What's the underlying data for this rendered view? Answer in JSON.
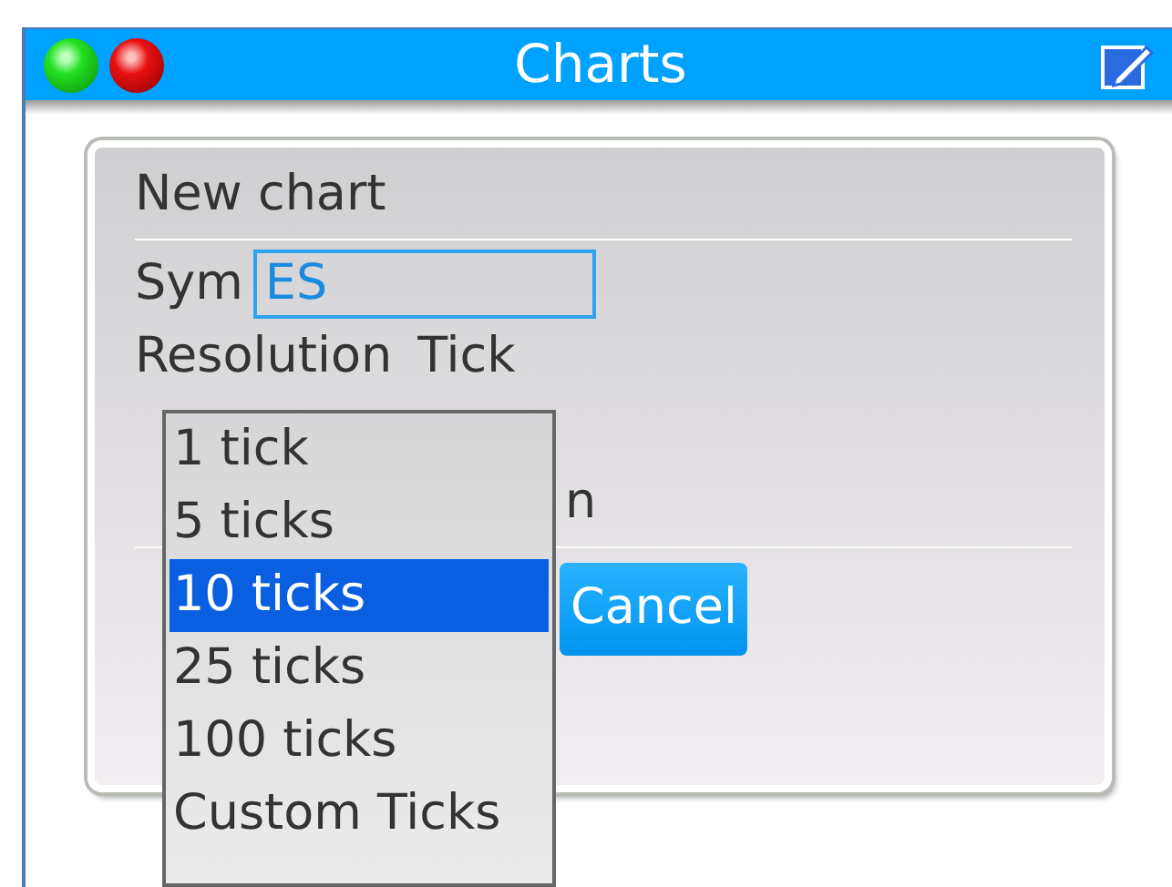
{
  "window": {
    "title": "Charts"
  },
  "dialog": {
    "title": "New chart",
    "fields": [
      {
        "kind": "input",
        "label": "Sym",
        "value": "ES"
      },
      {
        "kind": "choice",
        "label": "Resolution",
        "value": "Tick"
      }
    ],
    "partial_texts": [
      "n"
    ],
    "buttons": [
      {
        "label": "Cancel"
      }
    ]
  },
  "dropdown": {
    "options": [
      {
        "label": "1 tick",
        "selected": false
      },
      {
        "label": "5 ticks",
        "selected": false
      },
      {
        "label": "10 ticks",
        "selected": true
      },
      {
        "label": "25 ticks",
        "selected": false
      },
      {
        "label": "100 ticks",
        "selected": false
      },
      {
        "label": "Custom Ticks",
        "selected": false
      }
    ]
  }
}
